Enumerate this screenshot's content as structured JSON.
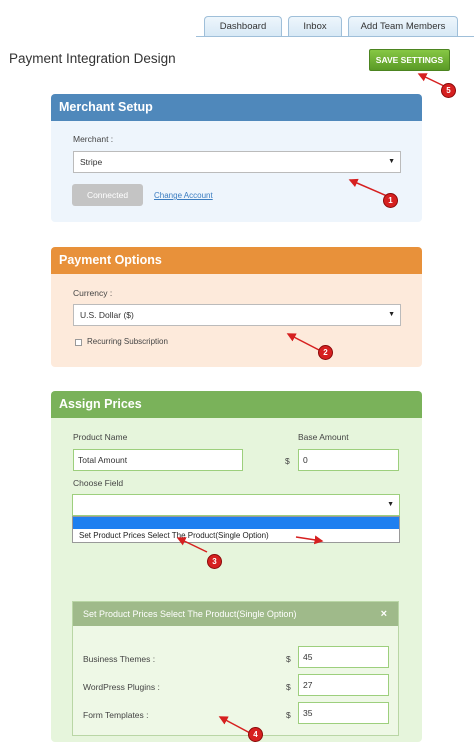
{
  "tabs": [
    "Dashboard",
    "Inbox",
    "Add Team Members"
  ],
  "page_title": "Payment Integration Design",
  "save_label": "SAVE SETTINGS",
  "merchant": {
    "title": "Merchant Setup",
    "merchant_label": "Merchant :",
    "merchant_value": "Stripe",
    "connected_label": "Connected",
    "change_account": "Change Account"
  },
  "payment": {
    "title": "Payment Options",
    "currency_label": "Currency :",
    "currency_value": "U.S. Dollar ($)",
    "recurring_label": "Recurring Subscription"
  },
  "prices": {
    "title": "Assign Prices",
    "product_name_label": "Product Name",
    "product_name_value": "Total Amount",
    "base_amount_label": "Base Amount",
    "currency_symbol": "$",
    "base_amount_value": "0",
    "choose_field_label": "Choose Field",
    "choose_field_value": "",
    "dropdown_option": "Set Product Prices Select The Product(Single Option)"
  },
  "modal": {
    "title": "Set Product Prices Select The Product(Single Option)",
    "close": "×",
    "rows": [
      {
        "label": "Business Themes :",
        "symbol": "$",
        "value": "45"
      },
      {
        "label": "WordPress Plugins :",
        "symbol": "$",
        "value": "27"
      },
      {
        "label": "Form Templates :",
        "symbol": "$",
        "value": "35"
      }
    ]
  },
  "markers": [
    "1",
    "2",
    "3",
    "4",
    "5"
  ],
  "colors": {
    "merchant_head": "#4f88bb",
    "merchant_body": "#eef5fc",
    "payment_head": "#e8913a",
    "payment_body": "#fdeadb",
    "prices_head": "#7ab25a",
    "prices_body": "#e6f5dc",
    "modal_head": "#9fba8a",
    "save_button": "#6fb032",
    "marker": "#d62020"
  }
}
